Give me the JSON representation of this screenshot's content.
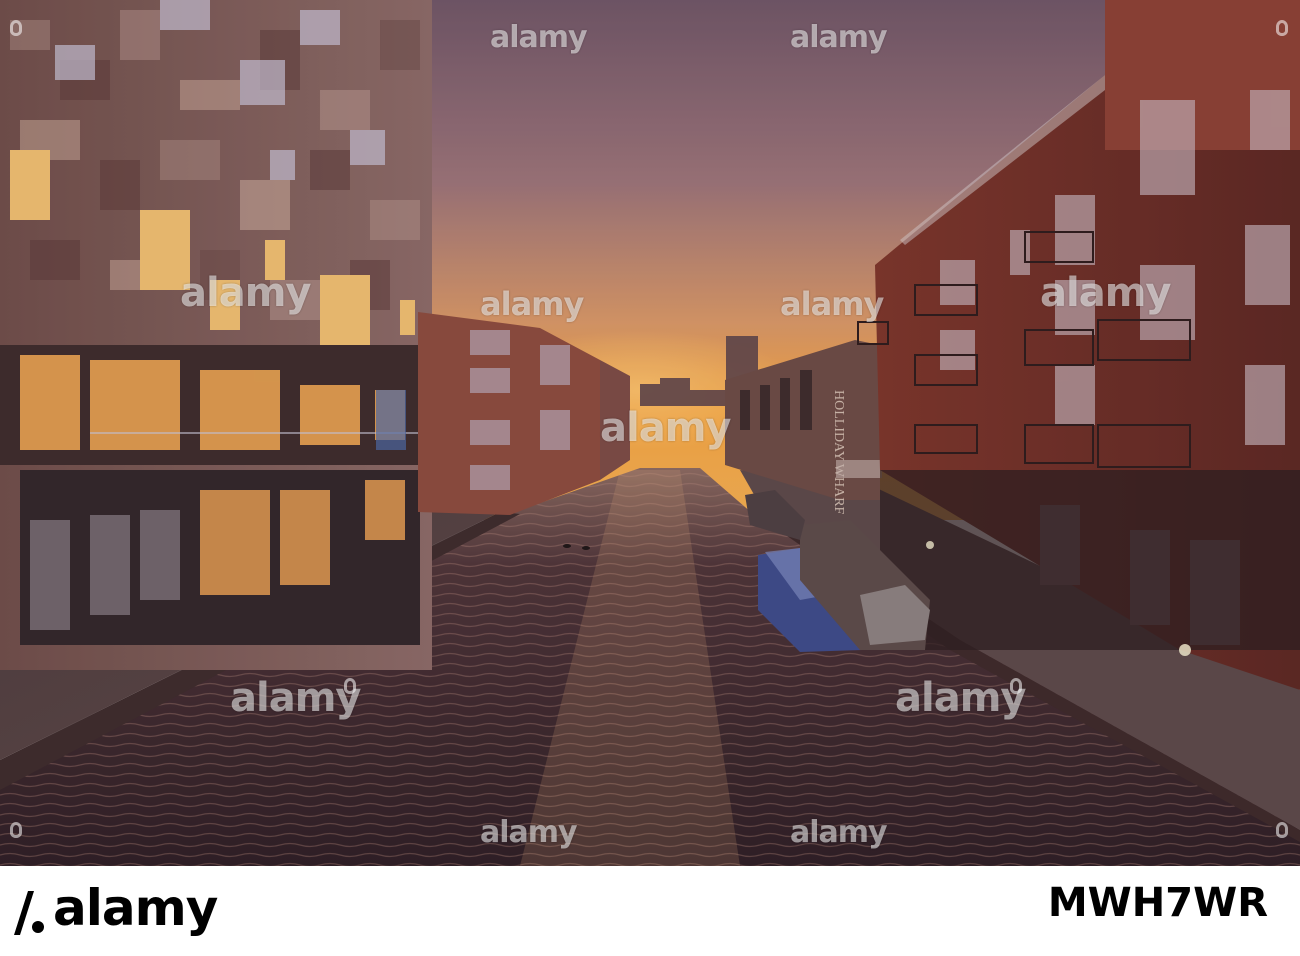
{
  "image": {
    "description_colors": {
      "sky_top": "#7b6070",
      "sky_horizon": "#f7a63e",
      "water": "#3a2a30",
      "brick": "#8a3a2c"
    }
  },
  "scene_signs": {
    "warehouse_sign": "HOLLIDAY WHARF"
  },
  "watermark": {
    "text": "alamy"
  },
  "footer": {
    "brand": "alamy",
    "stock_id": "MWH7WR"
  }
}
